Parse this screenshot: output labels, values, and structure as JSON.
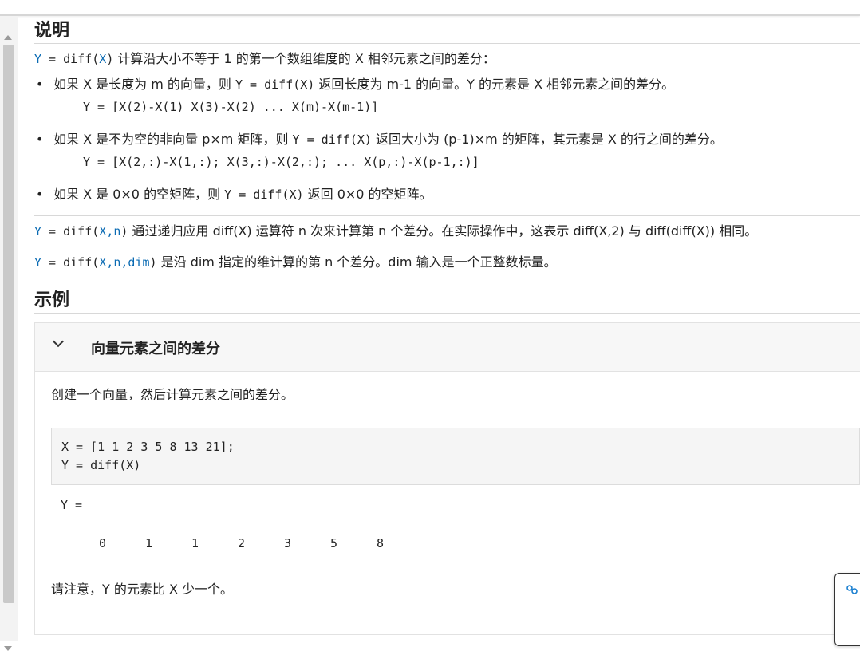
{
  "description": {
    "heading": "说明",
    "syntax1": {
      "code_y": "Y",
      "code_eq": " = diff(",
      "code_x": "X",
      "code_close": ")",
      "text": " 计算沿大小不等于 1 的第一个数组维度的 X 相邻元素之间的差分："
    },
    "bullets": [
      {
        "text_a": "如果 X 是长度为 m 的向量，则 ",
        "code": "Y = diff(X)",
        "text_b": " 返回长度为 m-1 的向量。Y 的元素是 X 相邻元素之间的差分。",
        "formula": "Y = [X(2)-X(1) X(3)-X(2) ... X(m)-X(m-1)]"
      },
      {
        "text_a": "如果 X 是不为空的非向量 p×m 矩阵，则 ",
        "code": "Y = diff(X)",
        "text_b": " 返回大小为 (p-1)×m 的矩阵，其元素是 X 的行之间的差分。",
        "formula": "Y = [X(2,:)-X(1,:); X(3,:)-X(2,:); ... X(p,:)-X(p-1,:)]"
      },
      {
        "text_a": "如果 X 是 0×0 的空矩阵，则 ",
        "code": "Y = diff(X)",
        "text_b": " 返回 0×0 的空矩阵。",
        "formula": ""
      }
    ],
    "syntax2": {
      "code_y": "Y",
      "code_eq": " = diff(",
      "code_args": "X,n",
      "code_close": ")",
      "text": " 通过递归应用 diff(X) 运算符 n 次来计算第 n 个差分。在实际操作中，这表示 diff(X,2) 与 diff(diff(X)) 相同。"
    },
    "syntax3": {
      "code_y": "Y",
      "code_eq": " = diff(",
      "code_args": "X,n,",
      "code_dim": "dim",
      "code_close": ")",
      "text": " 是沿 dim 指定的维计算的第 n 个差分。dim 输入是一个正整数标量。"
    }
  },
  "examples": {
    "heading": "示例",
    "example1": {
      "title": "向量元素之间的差分",
      "intro": "创建一个向量，然后计算元素之间的差分。",
      "code_lines": [
        "X = [1 1 2 3 5 8 13 21];",
        "Y = diff(X)"
      ],
      "output_label": "Y =",
      "output_values": [
        "0",
        "1",
        "1",
        "2",
        "3",
        "5",
        "8"
      ],
      "note": "请注意，Y 的元素比 X 少一个。"
    }
  },
  "icons": {
    "chevron": "chevron-down-icon",
    "float": "link-icon"
  },
  "colors": {
    "code_blue": "#0b6bb3"
  }
}
